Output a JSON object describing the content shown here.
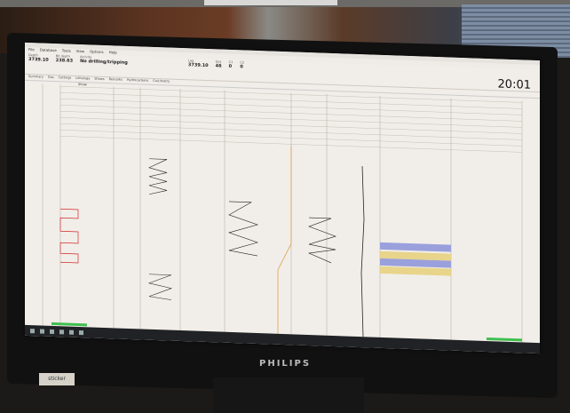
{
  "screen": {
    "clock": "20:01",
    "menu": [
      "File",
      "Database",
      "Tools",
      "View",
      "Options",
      "Help"
    ],
    "header": [
      {
        "label": "Depth",
        "value": "3739.10"
      },
      {
        "label": "Bit depth",
        "value": "238.63"
      },
      {
        "label": "Activity",
        "value": "No drilling/tripping"
      },
      {
        "label": "Lag",
        "value": "3739.10"
      },
      {
        "label": "Gas",
        "value": "46"
      },
      {
        "label": "C1",
        "value": "0"
      },
      {
        "label": "C2",
        "value": "0"
      }
    ],
    "tabs": [
      "Summary",
      "Gas",
      "Cuttings",
      "Lithology",
      "Shows",
      "Remarks",
      "Hydrocarbons",
      "Calcimetry"
    ],
    "filter": "Show:",
    "taskbar_items": [
      "start",
      "search",
      "files",
      "browser",
      "mail",
      "app"
    ]
  },
  "device": {
    "brand": "PHILIPS",
    "sticker": "sticker"
  },
  "colors": {
    "grid": "#b9b3aa",
    "trace_red": "#d22a2a",
    "trace_dark": "#222",
    "trace_orange": "#e0a050",
    "band_purple": "#9aa0dc",
    "band_yellow": "#e8d48a"
  }
}
